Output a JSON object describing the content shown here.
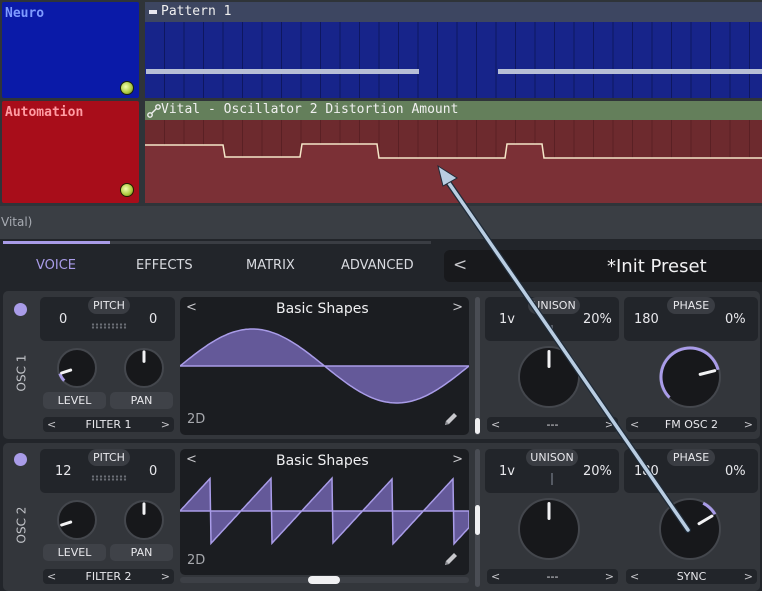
{
  "tracks": [
    {
      "name": "Neuro",
      "color": "#0a1aa8"
    },
    {
      "name": "Automation",
      "color": "#a80d1a"
    }
  ],
  "clips": {
    "pattern_title": "Pattern 1",
    "automation_title": "Vital - Oscillator 2 Distortion Amount"
  },
  "vital": {
    "host_label": "Vital)",
    "tabs": [
      "VOICE",
      "EFFECTS",
      "MATRIX",
      "ADVANCED"
    ],
    "active_tab": "VOICE",
    "preset": {
      "prev": "<",
      "name": "*Init Preset"
    },
    "osc1": {
      "name": "OSC 1",
      "pitch_label": "PITCH",
      "pitch_left": "0",
      "pitch_right": "0",
      "level_label": "LEVEL",
      "pan_label": "PAN",
      "filter_label": "FILTER 1",
      "wave_title": "Basic Shapes",
      "wave_mode": "2D",
      "unison_label": "UNISON",
      "unison_voices": "1v",
      "unison_detune": "20%",
      "unison_select": "---",
      "phase_label": "PHASE",
      "phase_value": "180",
      "phase_random": "0%",
      "phase_select": "FM OSC 2"
    },
    "osc2": {
      "name": "OSC 2",
      "pitch_label": "PITCH",
      "pitch_left": "12",
      "pitch_right": "0",
      "level_label": "LEVEL",
      "pan_label": "PAN",
      "filter_label": "FILTER 2",
      "wave_title": "Basic Shapes",
      "wave_mode": "2D",
      "unison_label": "UNISON",
      "unison_voices": "1v",
      "unison_detune": "20%",
      "unison_select": "---",
      "phase_label": "PHASE",
      "phase_value": "180",
      "phase_random": "0%",
      "phase_select": "SYNC"
    }
  },
  "colors": {
    "accent": "#a99ce8",
    "annotation_arrow": "#b9cde2"
  }
}
